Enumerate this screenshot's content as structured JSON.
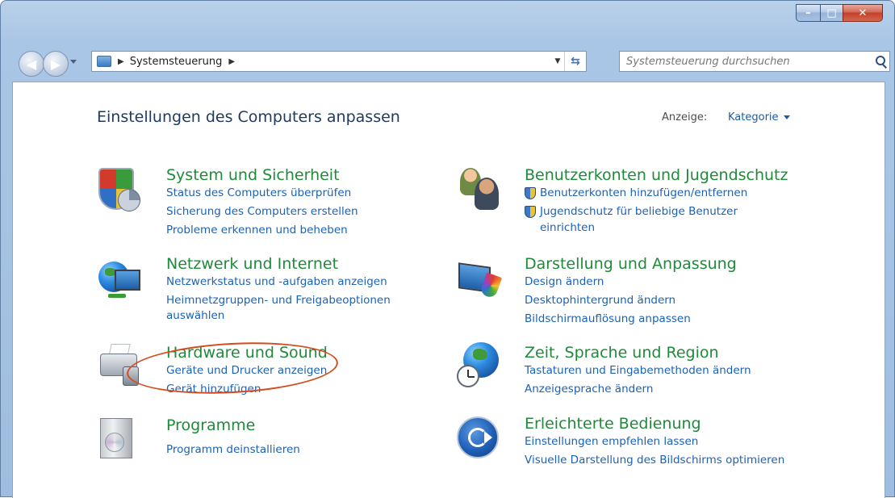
{
  "window": {
    "caption_buttons": {
      "minimize": "–",
      "maximize": "□",
      "close": "✕"
    }
  },
  "navbar": {
    "breadcrumb": [
      "Systemsteuerung"
    ],
    "search_placeholder": "Systemsteuerung durchsuchen"
  },
  "main": {
    "title": "Einstellungen des Computers anpassen",
    "view_label": "Anzeige:",
    "view_value": "Kategorie"
  },
  "categories": [
    {
      "title": "System und Sicherheit",
      "links": [
        "Status des Computers überprüfen",
        "Sicherung des Computers erstellen",
        "Probleme erkennen und beheben"
      ]
    },
    {
      "title": "Netzwerk und Internet",
      "links": [
        "Netzwerkstatus und -aufgaben anzeigen",
        "Heimnetzgruppen- und Freigabeoptionen",
        "auswählen"
      ]
    },
    {
      "title": "Hardware und Sound",
      "links": [
        "Geräte und Drucker anzeigen",
        "Gerät hinzufügen"
      ]
    },
    {
      "title": "Programme",
      "links": [
        "Programm deinstallieren"
      ]
    },
    {
      "title": "Benutzerkonten und Jugendschutz",
      "links": [
        "Benutzerkonten hinzufügen/entfernen",
        "Jugendschutz für beliebige Benutzer",
        "einrichten"
      ]
    },
    {
      "title": "Darstellung und Anpassung",
      "links": [
        "Design ändern",
        "Desktophintergrund ändern",
        "Bildschirmauflösung anpassen"
      ]
    },
    {
      "title": "Zeit, Sprache und Region",
      "links": [
        "Tastaturen und Eingabemethoden ändern",
        "Anzeigesprache ändern"
      ]
    },
    {
      "title": "Erleichterte Bedienung",
      "links": [
        "Einstellungen empfehlen lassen",
        "Visuelle Darstellung des Bildschirms optimieren"
      ]
    }
  ],
  "annotation": {
    "color": "#d54a1c"
  }
}
